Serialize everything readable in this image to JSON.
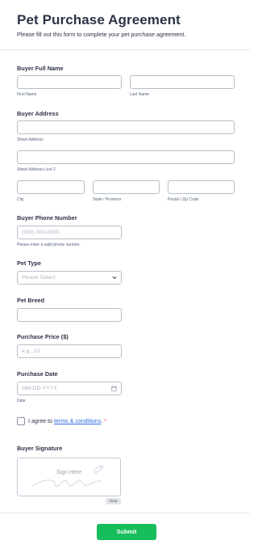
{
  "form": {
    "title": "Pet Purchase Agreement",
    "subtitle": "Please fill out this form to complete your pet purchase agreement."
  },
  "buyer_name": {
    "label": "Buyer Full Name",
    "first_sub": "First Name",
    "last_sub": "Last Name"
  },
  "buyer_address": {
    "label": "Buyer Address",
    "street_sub": "Street Address",
    "street2_sub": "Street Address Line 2",
    "city_sub": "City",
    "state_sub": "State / Province",
    "postal_sub": "Postal / Zip Code"
  },
  "phone": {
    "label": "Buyer Phone Number",
    "placeholder": "(000) 000-0000",
    "hint": "Please enter a valid phone number."
  },
  "pet_type": {
    "label": "Pet Type",
    "selected": "Please Select",
    "icon": "chevron-down-icon"
  },
  "pet_breed": {
    "label": "Pet Breed"
  },
  "price": {
    "label": "Purchase Price ($)",
    "placeholder": "e.g., 23"
  },
  "date": {
    "label": "Purchase Date",
    "placeholder": "MM-DD-YYYY",
    "sub": "Date",
    "icon": "calendar-icon"
  },
  "terms": {
    "prefix": "I agree to ",
    "link": "terms & conditions",
    "suffix": ".",
    "required_mark": "*"
  },
  "signature": {
    "label": "Buyer Signature",
    "pad_text": "Sign Here",
    "clear_label": "Clear"
  },
  "submit_label": "Submit",
  "colors": {
    "accent": "#18bd5b",
    "link": "#2f6fe4",
    "required": "#f23a3c",
    "text": "#2c3345"
  }
}
